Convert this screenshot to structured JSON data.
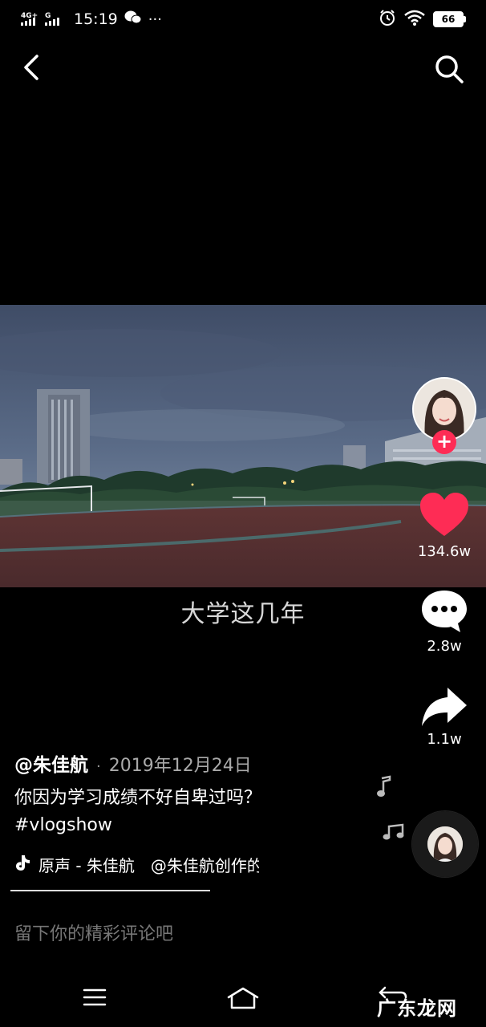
{
  "status_bar": {
    "network": "4G+ G",
    "time": "15:19",
    "more": "···",
    "battery": "66"
  },
  "video": {
    "caption": "大学这几年"
  },
  "rail": {
    "likes": "134.6w",
    "comments": "2.8w",
    "shares": "1.1w"
  },
  "post": {
    "author": "@朱佳航",
    "separator": "·",
    "date": "2019年12月24日",
    "description": "你因为学习成绩不好自卑过吗？",
    "hashtag": "#vlogshow",
    "music_text": "原声 - 朱佳航　@朱佳航创作的原声"
  },
  "comment": {
    "placeholder": "留下你的精彩评论吧"
  },
  "watermark": "广东龙网",
  "colors": {
    "like": "#fe2c55",
    "follow": "#fe2c55",
    "background": "#000000"
  }
}
